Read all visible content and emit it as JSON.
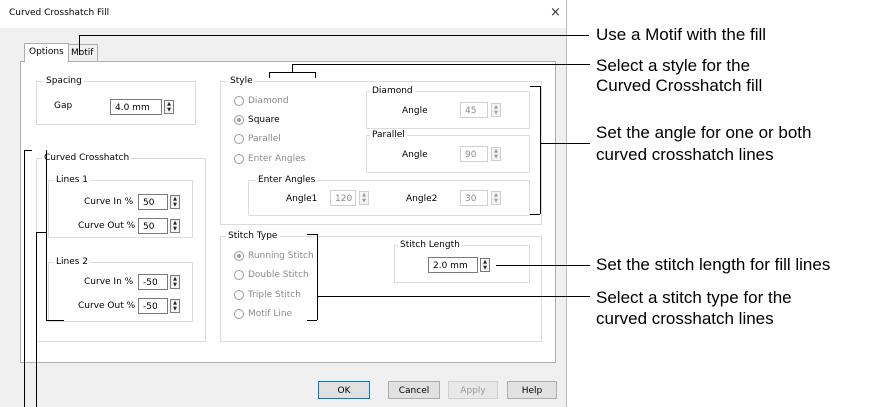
{
  "window": {
    "title": "Curved Crosshatch Fill",
    "close_glyph": "×"
  },
  "tabs": [
    {
      "label": "Options"
    },
    {
      "label": "Motif"
    }
  ],
  "spacing": {
    "label": "Spacing",
    "gap_label": "Gap",
    "gap_value": "4.0 mm"
  },
  "curved_crosshatch": {
    "label": "Curved Crosshatch",
    "lines1": {
      "label": "Lines 1",
      "curve_in_label": "Curve In %",
      "curve_in_value": "50",
      "curve_out_label": "Curve Out %",
      "curve_out_value": "50"
    },
    "lines2": {
      "label": "Lines 2",
      "curve_in_label": "Curve In %",
      "curve_in_value": "-50",
      "curve_out_label": "Curve Out %",
      "curve_out_value": "-50"
    }
  },
  "style": {
    "label": "Style",
    "options": [
      "Diamond",
      "Square",
      "Parallel",
      "Enter Angles"
    ],
    "selected": "Square",
    "diamond": {
      "label": "Diamond",
      "angle_label": "Angle",
      "angle_value": "45"
    },
    "parallel": {
      "label": "Parallel",
      "angle_label": "Angle",
      "angle_value": "90"
    },
    "enter_angles": {
      "label": "Enter Angles",
      "angle1_label": "Angle1",
      "angle1_value": "120",
      "angle2_label": "Angle2",
      "angle2_value": "30"
    }
  },
  "stitch_type": {
    "label": "Stitch Type",
    "options": [
      "Running Stitch",
      "Double Stitch",
      "Triple Stitch",
      "Motif Line"
    ],
    "selected": "Running Stitch",
    "length_label": "Stitch Length",
    "length_value": "2.0 mm"
  },
  "buttons": {
    "ok": "OK",
    "cancel": "Cancel",
    "apply": "Apply",
    "help": "Help"
  },
  "callouts": {
    "motif": "Use a Motif with the fill",
    "style_line1": "Select a style for the",
    "style_line2": "Curved Crosshatch fill",
    "angle_line1": "Set the angle for one or both",
    "angle_line2": "curved crosshatch lines",
    "stitch_length": "Set the stitch length for fill lines",
    "stitch_type_line1": "Select a stitch type for the",
    "stitch_type_line2": "curved crosshatch lines"
  },
  "icons": {
    "spin": "spin-up-down-icon",
    "close": "close-icon"
  }
}
